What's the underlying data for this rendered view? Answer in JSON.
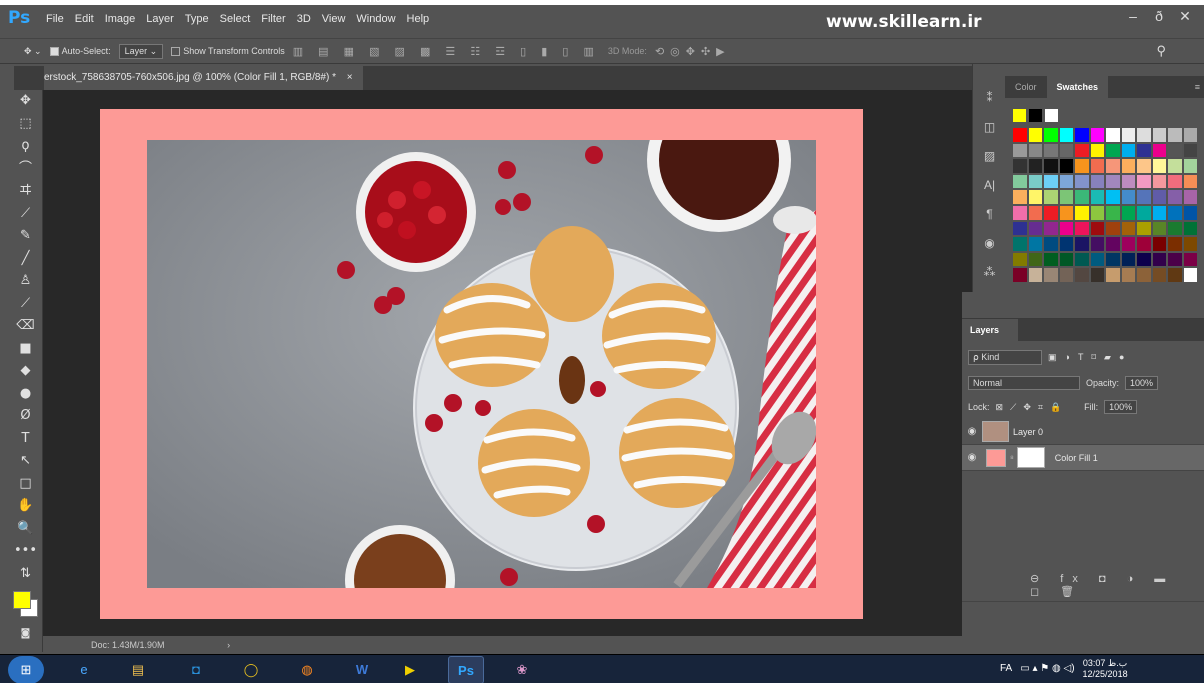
{
  "app": {
    "logo": "Ps",
    "watermark": "www.skillearn.ir"
  },
  "menu": [
    "File",
    "Edit",
    "Image",
    "Layer",
    "Type",
    "Select",
    "Filter",
    "3D",
    "View",
    "Window",
    "Help"
  ],
  "window_buttons": {
    "minimize": "–",
    "restore": "ð",
    "close": "✕"
  },
  "options": {
    "move_icon": "✥ ⌄",
    "autoselect_label": "Auto-Select:",
    "autoselect_value": "Layer",
    "transform_label": "Show Transform Controls",
    "mode3d_label": "3D Mode:",
    "search_icon": "⚲"
  },
  "document": {
    "tab_title": "erstock_758638705-760x506.jpg @ 100% (Color Fill 1, RGB/8#) *",
    "close": "×",
    "status": "Doc: 1.43M/1.90M",
    "fill_color": "#fd9a96"
  },
  "tools": [
    "✥",
    "⬚",
    "ϙ",
    "⌒",
    "ヰ",
    "⟋",
    "✎",
    "╱",
    "♙",
    "⟋",
    "⌫",
    "■",
    "◆",
    "●",
    "Ø",
    "T",
    "↖",
    "□",
    "✋",
    "🔍",
    "•••",
    "⇅"
  ],
  "colors": {
    "foreground": "#ffff00",
    "background": "#ffffff"
  },
  "swatches_panel": {
    "tabs": [
      "Color",
      "Swatches"
    ],
    "active_tab": "Swatches",
    "recent": [
      "#ffff00",
      "#000000",
      "#ffffff"
    ],
    "grid": [
      "#ff0000",
      "#ffff00",
      "#00ff00",
      "#00ffff",
      "#0000ff",
      "#ff00ff",
      "#ffffff",
      "#eeeeee",
      "#dddddd",
      "#cccccc",
      "#bbbbbb",
      "#aaaaaa",
      "#999999",
      "#888888",
      "#777777",
      "#666666",
      "#ed1c24",
      "#fff200",
      "#00a651",
      "#00aeef",
      "#2e3192",
      "#ec008c",
      "#555555",
      "#444444",
      "#333333",
      "#222222",
      "#111111",
      "#000000",
      "#f7941d",
      "#f26c4f",
      "#f69679",
      "#fbaf5d",
      "#fdc689",
      "#fff799",
      "#c4df9b",
      "#a3d39c",
      "#82ca9c",
      "#7accc8",
      "#6dcff6",
      "#7da7d9",
      "#8393ca",
      "#8781bd",
      "#a187be",
      "#bd8cbf",
      "#f49ac2",
      "#f5989d",
      "#f26d7d",
      "#f68e56",
      "#fbaf5d",
      "#fff568",
      "#acd373",
      "#7cc576",
      "#3bb878",
      "#1abbb4",
      "#00bff3",
      "#448ccb",
      "#5574b9",
      "#605ca8",
      "#855fa8",
      "#a864a8",
      "#f06eaa",
      "#f26c4f",
      "#ed1c24",
      "#f7941d",
      "#fff200",
      "#8dc63f",
      "#39b54a",
      "#00a651",
      "#00a99d",
      "#00aeef",
      "#0072bc",
      "#0054a6",
      "#2e3192",
      "#662d91",
      "#92278f",
      "#ec008c",
      "#ed145b",
      "#9e0b0f",
      "#a0410d",
      "#a36209",
      "#aba000",
      "#598527",
      "#1a7b30",
      "#007236",
      "#00746b",
      "#0076a3",
      "#004b80",
      "#003471",
      "#1b1464",
      "#440e62",
      "#630460",
      "#9e005d",
      "#9e0039",
      "#790000",
      "#7b2e00",
      "#7d4900",
      "#827b00",
      "#406618",
      "#005e20",
      "#005826",
      "#005952",
      "#005b7f",
      "#003663",
      "#002157",
      "#0d004c",
      "#32004b",
      "#4b0049",
      "#7b0046",
      "#7a0026",
      "#c7b299",
      "#998675",
      "#736357",
      "#534741",
      "#37302a",
      "#c69c6d",
      "#a67c52",
      "#8c6239",
      "#754c24",
      "#603913",
      "#ffffff"
    ]
  },
  "layers_panel": {
    "title": "Layers",
    "kind": "⍴ Kind",
    "blend_mode": "Normal",
    "opacity_label": "Opacity:",
    "opacity": "100%",
    "lock_label": "Lock:",
    "fill_label": "Fill:",
    "fill": "100%",
    "layers": [
      {
        "name": "Layer 0",
        "thumb": "#b09080"
      },
      {
        "name": "Color Fill 1",
        "thumb": "#fd9a96"
      }
    ],
    "bottom_icons": "⊖ fx ◘ ◑ ▬ ◻ 🗑"
  },
  "taskbar": {
    "apps": [
      "⊞",
      "e",
      "▤",
      "◘",
      "◯",
      "◍",
      "W",
      "▶",
      "Ps",
      "❀"
    ],
    "lang": "FA",
    "time": "03:07 ب.ظ",
    "date": "12/25/2018"
  }
}
